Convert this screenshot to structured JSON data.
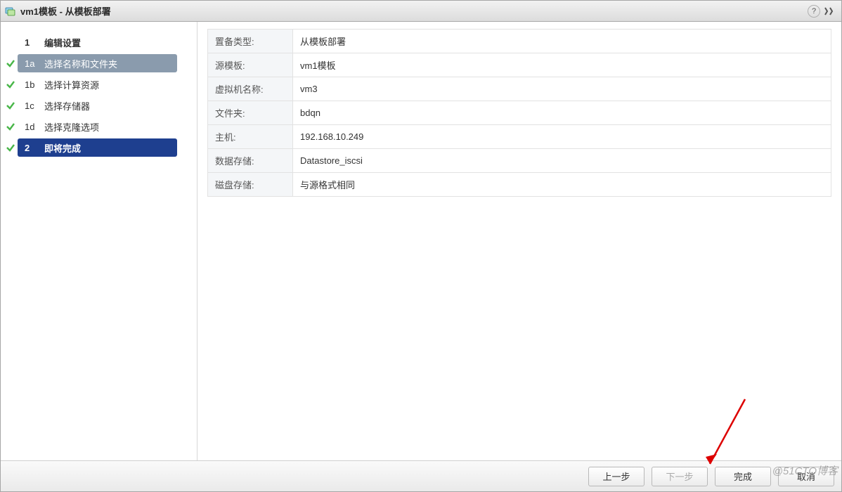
{
  "title": "vm1模板 - 从模板部署",
  "sidebar": {
    "step1": {
      "num": "1",
      "label": "编辑设置"
    },
    "steps": [
      {
        "num": "1a",
        "label": "选择名称和文件夹"
      },
      {
        "num": "1b",
        "label": "选择计算资源"
      },
      {
        "num": "1c",
        "label": "选择存储器"
      },
      {
        "num": "1d",
        "label": "选择克隆选项"
      }
    ],
    "step2": {
      "num": "2",
      "label": "即将完成"
    }
  },
  "summary": [
    {
      "key": "置备类型:",
      "val": "从模板部署"
    },
    {
      "key": "源模板:",
      "val": "vm1模板"
    },
    {
      "key": "虚拟机名称:",
      "val": "vm3"
    },
    {
      "key": "文件夹:",
      "val": "bdqn"
    },
    {
      "key": "主机:",
      "val": "192.168.10.249"
    },
    {
      "key": "数据存储:",
      "val": "Datastore_iscsi"
    },
    {
      "key": "磁盘存储:",
      "val": "与源格式相同"
    }
  ],
  "buttons": {
    "back": "上一步",
    "next": "下一步",
    "finish": "完成",
    "cancel": "取消"
  },
  "watermark": "@51CTO博客"
}
